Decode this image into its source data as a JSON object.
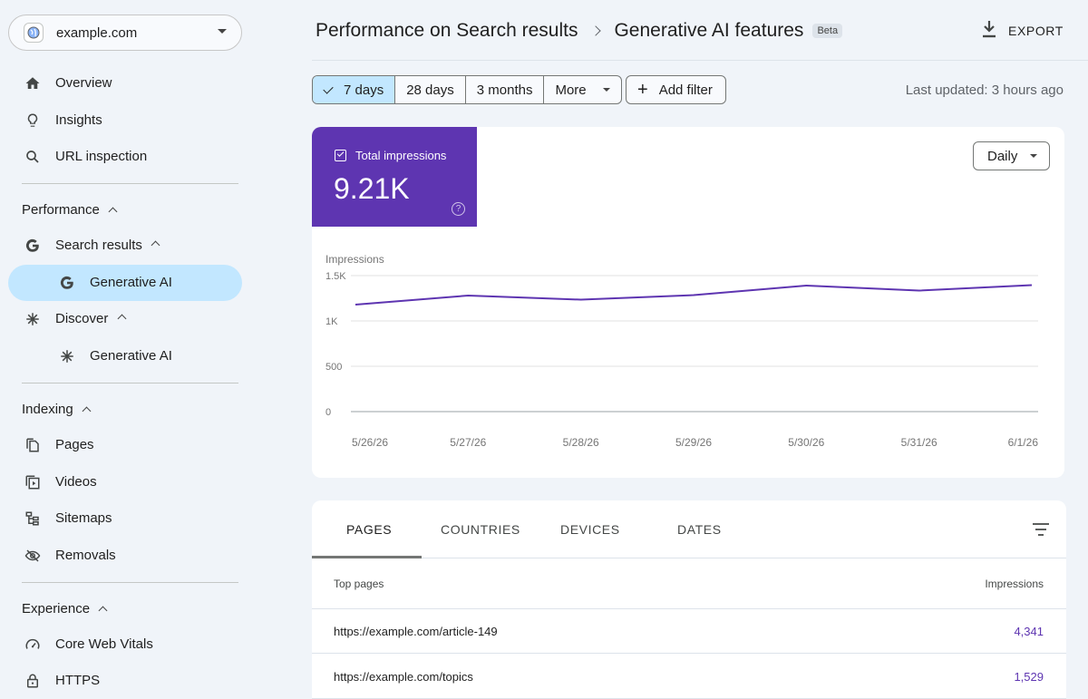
{
  "property": {
    "name": "example.com"
  },
  "sidebar": {
    "overview": "Overview",
    "insights": "Insights",
    "url_inspection": "URL inspection",
    "performance": "Performance",
    "search_results": "Search results",
    "search_gen_ai": "Generative AI",
    "discover": "Discover",
    "discover_gen_ai": "Generative AI",
    "indexing": "Indexing",
    "pages": "Pages",
    "videos": "Videos",
    "sitemaps": "Sitemaps",
    "removals": "Removals",
    "experience": "Experience",
    "core_web_vitals": "Core Web Vitals",
    "https": "HTTPS"
  },
  "header": {
    "breadcrumb_parent": "Performance on Search results",
    "breadcrumb_current": "Generative AI features",
    "badge": "Beta",
    "export": "EXPORT"
  },
  "filters": {
    "range_7": "7 days",
    "range_28": "28 days",
    "range_3m": "3 months",
    "more": "More",
    "add_filter": "Add filter",
    "last_updated": "Last updated: 3 hours ago"
  },
  "metric": {
    "label": "Total impressions",
    "value": "9.21K",
    "help": "?"
  },
  "granularity": "Daily",
  "chart_data": {
    "type": "line",
    "ylabel": "Impressions",
    "x": [
      "5/26/26",
      "5/27/26",
      "5/28/26",
      "5/29/26",
      "5/30/26",
      "5/31/26",
      "6/1/26"
    ],
    "values": [
      1180,
      1280,
      1235,
      1285,
      1390,
      1335,
      1395
    ],
    "yticks": [
      0,
      500,
      1000,
      1500
    ],
    "ytick_labels": [
      "0",
      "500",
      "1K",
      "1.5K"
    ],
    "ylim": [
      0,
      1500
    ],
    "color": "#5e35b1"
  },
  "table": {
    "tabs": [
      "PAGES",
      "COUNTRIES",
      "DEVICES",
      "DATES"
    ],
    "col_page": "Top pages",
    "col_impressions": "Impressions",
    "rows": [
      {
        "page": "https://example.com/article-149",
        "impressions": "4,341"
      },
      {
        "page": "https://example.com/topics",
        "impressions": "1,529"
      }
    ]
  }
}
